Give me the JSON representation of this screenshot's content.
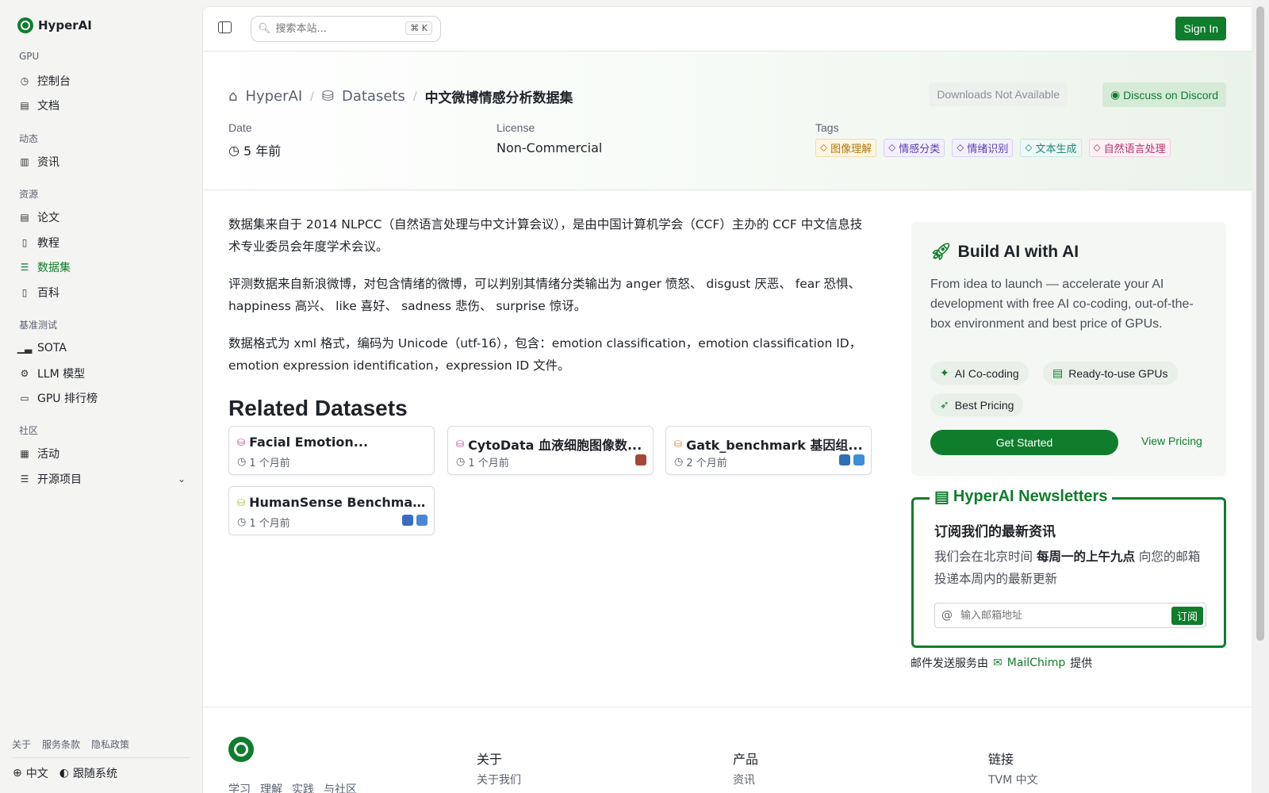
{
  "brand": {
    "name": "HyperAI",
    "color": "#0f7d2c"
  },
  "sidebar": {
    "sections": [
      {
        "title": "GPU",
        "items": [
          {
            "label": "控制台",
            "icon": "gauge-icon"
          },
          {
            "label": "文档",
            "icon": "book-icon"
          }
        ]
      },
      {
        "title": "动态",
        "items": [
          {
            "label": "资讯",
            "icon": "newspaper-icon"
          }
        ]
      },
      {
        "title": "资源",
        "items": [
          {
            "label": "论文",
            "icon": "paper-icon"
          },
          {
            "label": "教程",
            "icon": "tutorial-icon"
          },
          {
            "label": "数据集",
            "icon": "database-icon",
            "active": true
          },
          {
            "label": "百科",
            "icon": "wiki-icon"
          }
        ]
      },
      {
        "title": "基准测试",
        "items": [
          {
            "label": "SOTA",
            "icon": "chart-icon"
          },
          {
            "label": "LLM 模型",
            "icon": "cpu-icon"
          },
          {
            "label": "GPU 排行榜",
            "icon": "leaderboard-icon"
          }
        ]
      },
      {
        "title": "社区",
        "items": [
          {
            "label": "活动",
            "icon": "events-icon"
          },
          {
            "label": "开源项目",
            "icon": "list-icon"
          }
        ]
      }
    ],
    "footer_links": [
      "关于",
      "服务条款",
      "隐私政策"
    ],
    "language": "中文",
    "theme": "跟随系统"
  },
  "topbar": {
    "search_placeholder": "搜索本站...",
    "shortcut": "⌘ K",
    "signin": "Sign In"
  },
  "hero": {
    "breadcrumb": {
      "home": "HyperAI",
      "section": "Datasets",
      "current": "中文微博情感分析数据集"
    },
    "downloads": "Downloads Not Available",
    "discord": "Discuss on Discord",
    "date_label": "Date",
    "date_value": "5 年前",
    "license_label": "License",
    "license_value": "Non-Commercial",
    "tags_label": "Tags",
    "tags": [
      {
        "label": "图像理解",
        "color": "#b07a10",
        "bg": "#fdf6e3",
        "border": "#f0dcae"
      },
      {
        "label": "情感分类",
        "color": "#5a3fb0",
        "bg": "#f3f0fc",
        "border": "#d9d0f2"
      },
      {
        "label": "情绪识别",
        "color": "#5a3fb0",
        "bg": "#f3f0fc",
        "border": "#d9d0f2"
      },
      {
        "label": "文本生成",
        "color": "#1f8a7a",
        "bg": "#eef8f6",
        "border": "#c8e8e1"
      },
      {
        "label": "自然语言处理",
        "color": "#b0356b",
        "bg": "#fcf0f5",
        "border": "#f2cde0"
      }
    ]
  },
  "content": {
    "paragraphs": [
      "数据集来自于 2014 NLPCC（自然语言处理与中文计算会议），是由中国计算机学会（CCF）主办的 CCF 中文信息技术专业委员会年度学术会议。",
      "评测数据来自新浪微博，对包含情绪的微博，可以判别其情绪分类输出为 anger 愤怒、 disgust 厌恶、 fear 恐惧、 happiness 高兴、 like 喜好、 sadness 悲伤、 surprise 惊讶。",
      "数据格式为 xml 格式，编码为 Unicode（utf-16），包含：emotion classification，emotion classification ID，emotion expression identification，expression ID 文件。"
    ]
  },
  "related": {
    "title": "Related Datasets",
    "items": [
      {
        "name": "Facial Emotion...",
        "time": "1 个月前",
        "icon_color": "#c2419a",
        "badges": []
      },
      {
        "name": "CytoData 血液细胞图像数...",
        "time": "1 个月前",
        "icon_color": "#c2419a",
        "badges": [
          "#a6453a"
        ]
      },
      {
        "name": "Gatk_benchmark 基因组...",
        "time": "2 个月前",
        "icon_color": "#d9822b",
        "badges": [
          "#2f6fb3",
          "#3d8fd6"
        ]
      },
      {
        "name": "HumanSense Benchmar...",
        "time": "1 个月前",
        "icon_color": "#a8b82d",
        "badges": [
          "#3b6cc4",
          "#4a87d6"
        ]
      }
    ]
  },
  "promo": {
    "title": "Build AI with AI",
    "desc": "From idea to launch — accelerate your AI development with free AI co-coding, out-of-the-box environment and best price of GPUs.",
    "pills": [
      "AI Co-coding",
      "Ready-to-use GPUs",
      "Best Pricing"
    ],
    "cta": "Get Started",
    "link": "View Pricing"
  },
  "newsletter": {
    "title": "HyperAI Newsletters",
    "heading": "订阅我们的最新资讯",
    "text_prefix": "我们会在北京时间 ",
    "text_bold": "每周一的上午九点",
    "text_suffix": " 向您的邮箱投递本周内的最新更新",
    "placeholder": "输入邮箱地址",
    "button": "订阅",
    "provider_prefix": "邮件发送服务由",
    "provider": "MailChimp",
    "provider_suffix": "提供"
  },
  "footer": {
    "tagline": [
      "学习",
      "理解",
      "实践",
      "与社区"
    ],
    "columns": [
      {
        "title": "关于",
        "first_link": "关于我们"
      },
      {
        "title": "产品",
        "first_link": "资讯"
      },
      {
        "title": "链接",
        "first_link": "TVM 中文"
      }
    ]
  }
}
